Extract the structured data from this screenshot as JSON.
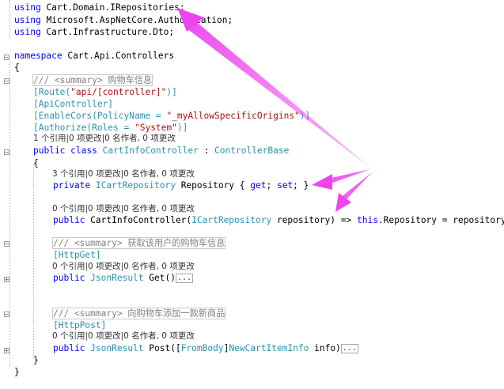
{
  "code": {
    "using1": "using",
    "using1_ns": "Cart.Domain.IRepositories;",
    "using2": "using",
    "using2_ns": "Microsoft.AspNetCore.Authorization;",
    "using3": "using",
    "using3_ns": "Cart.Infrastructure.Dto;",
    "namespace_kw": "namespace",
    "namespace_name": "Cart.Api.Controllers",
    "open_brace": "{",
    "summary_class": "/// <summary> 购物车信息",
    "route_attr": "[Route(",
    "route_str": "\"api/[controller]\"",
    "route_end": ")]",
    "api_controller": "[ApiController]",
    "cors_attr": "[EnableCors(PolicyName = ",
    "cors_str": "\"_myAllowSpecificOrigins\"",
    "cors_end": ")]",
    "authorize_attr": "[Authorize(Roles = ",
    "authorize_str": "\"System\"",
    "authorize_end": ")]",
    "codelens_class": "1 个引用|0 项更改|0 名作者, 0 项更改",
    "class_decl_kw": "public class",
    "class_name": "CartInfoController",
    "class_colon": " : ",
    "class_base": "ControllerBase",
    "class_open": "{",
    "codelens_prop": "3 个引用|0 项更改|0 名作者, 0 项更改",
    "prop_kw": "private",
    "prop_type": "ICartRepository",
    "prop_name": " Repository { ",
    "prop_get": "get",
    "prop_sep": "; ",
    "prop_set": "set",
    "prop_end": "; }",
    "codelens_ctor": "0 个引用|0 项更改|0 名作者, 0 项更改",
    "ctor_kw": "public",
    "ctor_name": "CartInfoController(",
    "ctor_param_type": "ICartRepository",
    "ctor_param": " repository) => ",
    "ctor_this": "this",
    "ctor_body": ".Repository = repository;",
    "summary_get": "/// <summary> 获取该用户的购物车信息",
    "httpget_attr": "[HttpGet]",
    "codelens_get": "0 个引用|0 项更改|0 名作者, 0 项更改",
    "get_kw": "public",
    "get_type": "JsonResult",
    "get_name": " Get()",
    "collapsed_marker": "...",
    "summary_post": "/// <summary> 向购物车添加一款新商品",
    "httppost_attr": "[HttpPost]",
    "codelens_post": "0 个引用|0 项更改|0 名作者, 0 项更改",
    "post_kw": "public",
    "post_type": "JsonResult",
    "post_name": " Post([",
    "post_frombody": "FromBody",
    "post_bracket": "]",
    "post_param_type": "NewCartItemInfo",
    "post_param": " info)",
    "class_close": "}",
    "namespace_close": "}"
  },
  "colors": {
    "keyword": "#0000ff",
    "type": "#2b91af",
    "string": "#a31515",
    "comment": "#808080",
    "arrow": "#ee44ee"
  }
}
